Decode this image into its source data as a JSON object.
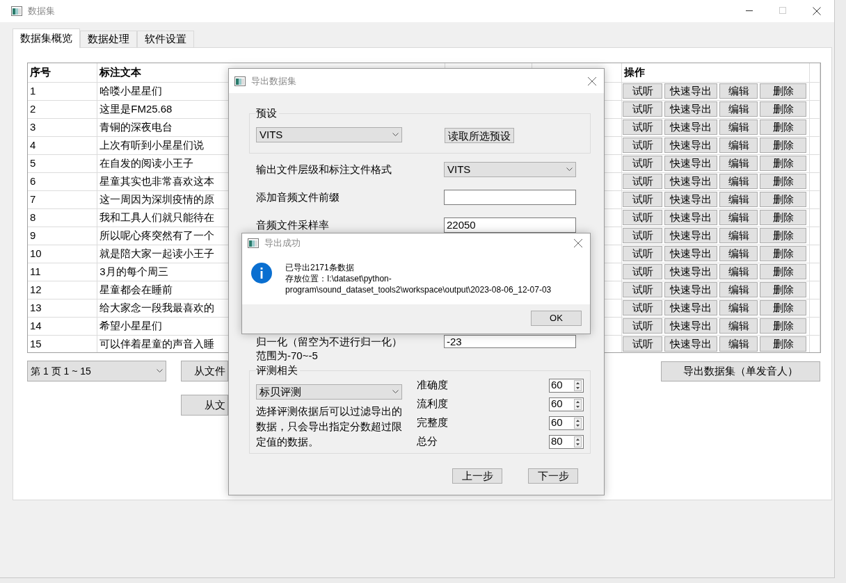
{
  "window": {
    "title": "数据集"
  },
  "tabs": [
    {
      "label": "数据集概览",
      "selected": true
    },
    {
      "label": "数据处理",
      "selected": false
    },
    {
      "label": "软件设置",
      "selected": false
    }
  ],
  "table": {
    "columns": [
      {
        "label": "序号"
      },
      {
        "label": "标注文本"
      },
      {
        "label": "操作"
      }
    ],
    "rows": [
      {
        "index": "1",
        "text": "哈喽小星星们",
        "actions": [
          "试听",
          "快速导出",
          "编辑",
          "删除"
        ]
      },
      {
        "index": "2",
        "text": "这里是FM25.68",
        "actions": [
          "试听",
          "快速导出",
          "编辑",
          "删除"
        ]
      },
      {
        "index": "3",
        "text": "青铜的深夜电台",
        "actions": [
          "试听",
          "快速导出",
          "编辑",
          "删除"
        ]
      },
      {
        "index": "4",
        "text": "上次有听到小星星们说",
        "actions": [
          "试听",
          "快速导出",
          "编辑",
          "删除"
        ]
      },
      {
        "index": "5",
        "text": "在自发的阅读小王子",
        "actions": [
          "试听",
          "快速导出",
          "编辑",
          "删除"
        ]
      },
      {
        "index": "6",
        "text": "星童其实也非常喜欢这本",
        "actions": [
          "试听",
          "快速导出",
          "编辑",
          "删除"
        ]
      },
      {
        "index": "7",
        "text": "这一周因为深圳疫情的原",
        "actions": [
          "试听",
          "快速导出",
          "编辑",
          "删除"
        ]
      },
      {
        "index": "8",
        "text": "我和工具人们就只能待在",
        "actions": [
          "试听",
          "快速导出",
          "编辑",
          "删除"
        ]
      },
      {
        "index": "9",
        "text": "所以呢心疼突然有了一个",
        "actions": [
          "试听",
          "快速导出",
          "编辑",
          "删除"
        ]
      },
      {
        "index": "10",
        "text": "就是陪大家一起读小王子",
        "actions": [
          "试听",
          "快速导出",
          "编辑",
          "删除"
        ]
      },
      {
        "index": "11",
        "text": "3月的每个周三",
        "actions": [
          "试听",
          "快速导出",
          "编辑",
          "删除"
        ]
      },
      {
        "index": "12",
        "text": "星童都会在睡前",
        "actions": [
          "试听",
          "快速导出",
          "编辑",
          "删除"
        ]
      },
      {
        "index": "13",
        "text": "给大家念一段我最喜欢的",
        "actions": [
          "试听",
          "快速导出",
          "编辑",
          "删除"
        ]
      },
      {
        "index": "14",
        "text": "希望小星星们",
        "actions": [
          "试听",
          "快速导出",
          "编辑",
          "删除"
        ]
      },
      {
        "index": "15",
        "text": "可以伴着星童的声音入睡",
        "actions": [
          "试听",
          "快速导出",
          "编辑",
          "删除"
        ]
      }
    ]
  },
  "page_select": {
    "value": "第 1 页  1 ~ 15"
  },
  "left_buttons": [
    "从文件",
    "从文"
  ],
  "export_button": "导出数据集（单发音人）",
  "export_dialog": {
    "title": "导出数据集",
    "preset_group": {
      "title": "预设",
      "value": "VITS",
      "button": "读取所选预设"
    },
    "fields": [
      {
        "kind": "select",
        "label": "输出文件层级和标注文件格式",
        "value": "VITS"
      },
      {
        "kind": "input",
        "label": "添加音频文件前缀"
      },
      {
        "kind": "input",
        "label": "音频文件采样率",
        "value": "22050"
      }
    ],
    "normalize": {
      "label": "归一化（留空为不进行归一化）",
      "hint": "范围为-70~-5",
      "value": "-23"
    },
    "eval_group": {
      "title": "评测相关",
      "value": "标贝评测",
      "note": "选择评测依据后可以过滤导出的数据，只会导出指定分数超过限定值的数据。",
      "scores": [
        {
          "label": "准确度",
          "value": "60"
        },
        {
          "label": "流利度",
          "value": "60"
        },
        {
          "label": "完整度",
          "value": "60"
        },
        {
          "label": "总分",
          "value": "80"
        }
      ]
    },
    "buttons": [
      "上一步",
      "下一步"
    ]
  },
  "message_box": {
    "title": "导出成功",
    "lines": [
      "已导出2171条数据",
      "存放位置：I:\\dataset\\python-",
      "program\\sound_dataset_tools2\\workspace\\output\\2023-08-06_12-07-03"
    ],
    "button": "OK"
  }
}
